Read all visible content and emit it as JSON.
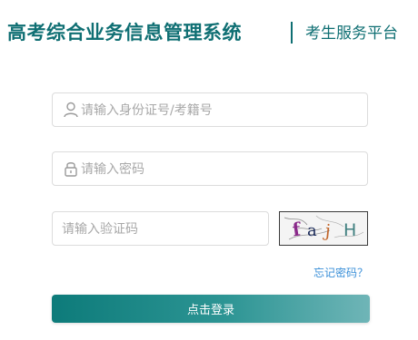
{
  "header": {
    "title": "高考综合业务信息管理系统",
    "subtitle": "考生服务平台"
  },
  "form": {
    "username_placeholder": "请输入身份证号/考籍号",
    "username_icon": "user-icon",
    "password_placeholder": "请输入密码",
    "password_icon": "lock-icon",
    "captcha_placeholder": "请输入验证码",
    "captcha_text": "faj H",
    "forgot_label": "忘记密码？",
    "login_label": "点击登录"
  },
  "colors": {
    "brand": "#0f6f73",
    "link": "#3a8fd8",
    "button_start": "#0d7b7a",
    "button_end": "#6fb5b7"
  }
}
